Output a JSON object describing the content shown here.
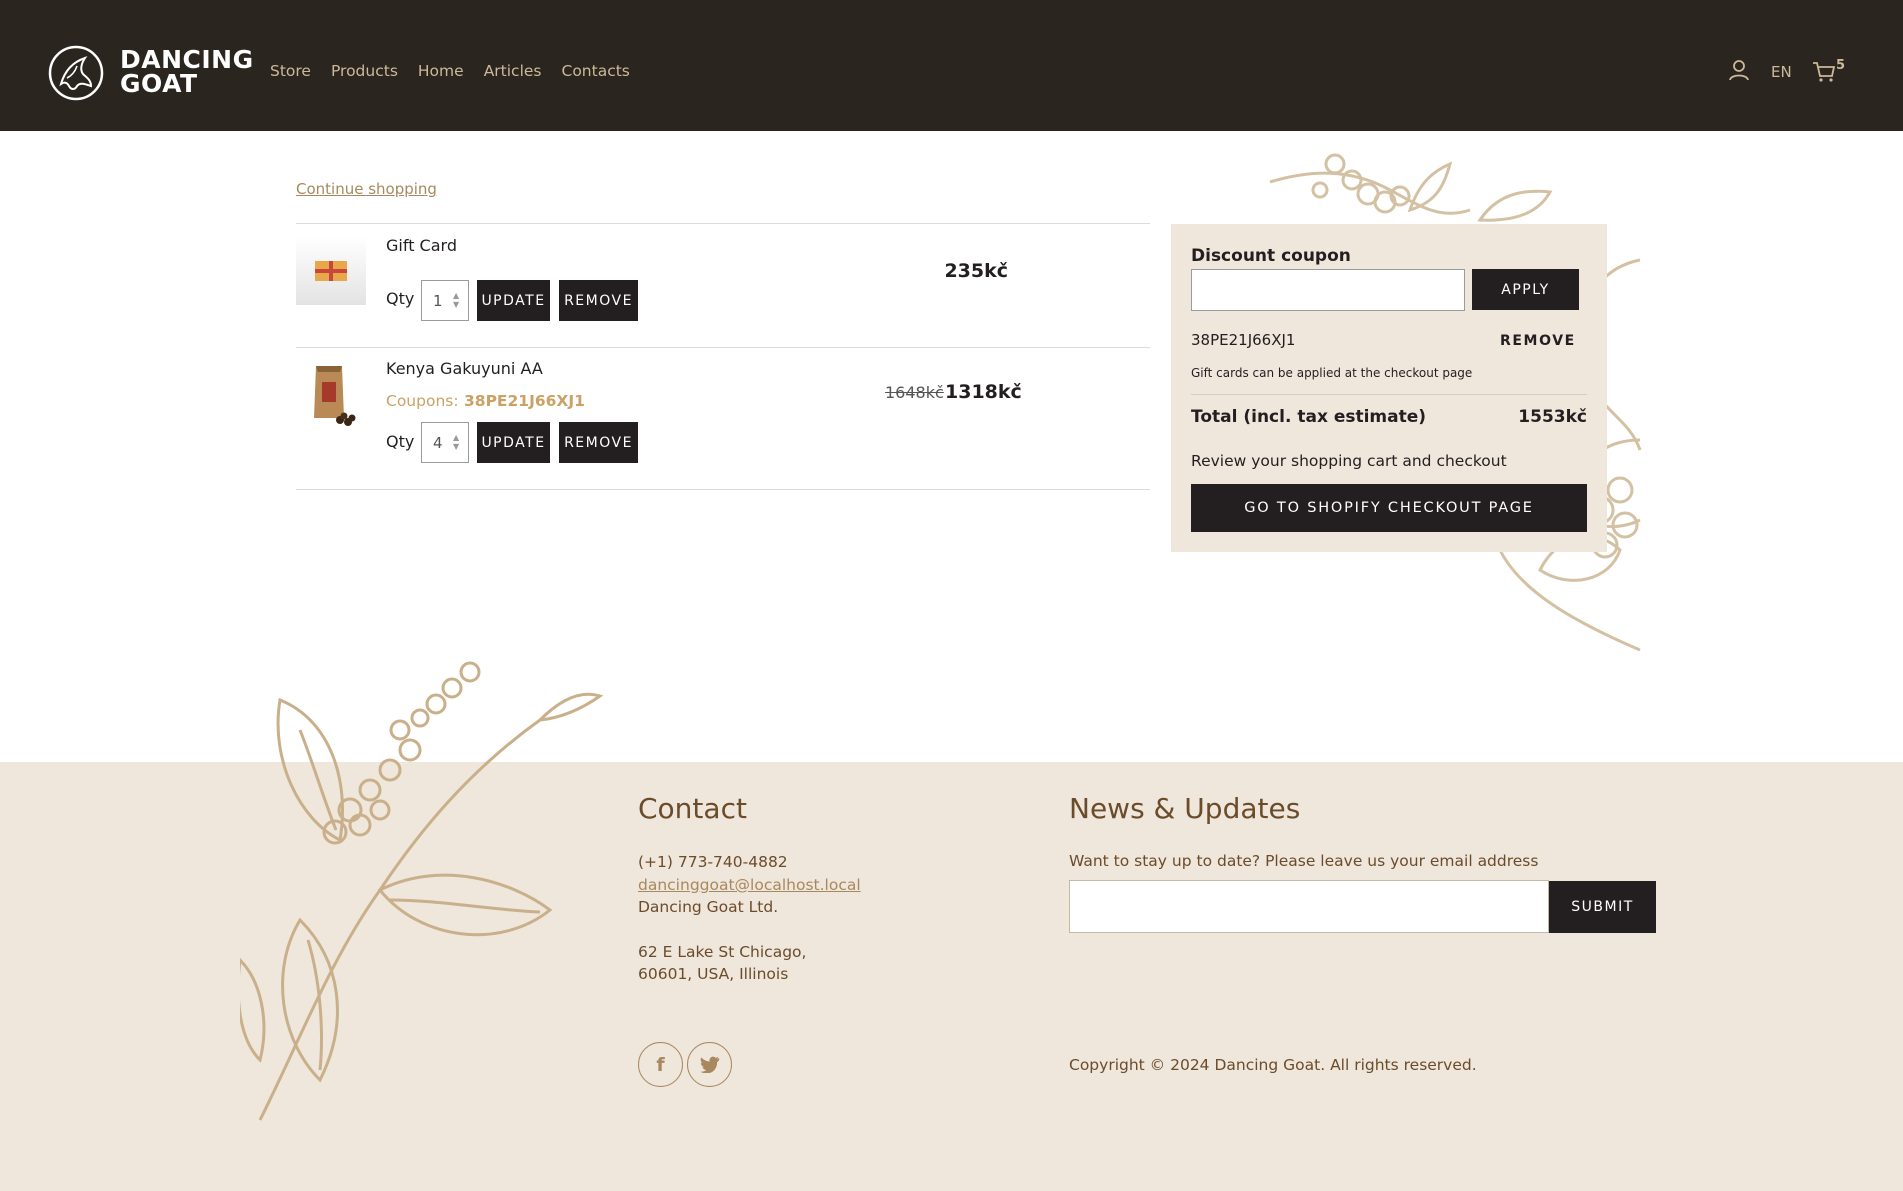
{
  "header": {
    "brand_line1": "DANCING",
    "brand_line2": "GOAT",
    "nav": [
      "Store",
      "Products",
      "Home",
      "Articles",
      "Contacts"
    ],
    "language": "EN",
    "cart_count": "5"
  },
  "cart": {
    "continue_label": "Continue shopping",
    "items": [
      {
        "name": "Gift Card",
        "qty_label": "Qty",
        "qty": "1",
        "update_label": "UPDATE",
        "remove_label": "REMOVE",
        "price": "235kč"
      },
      {
        "name": "Kenya Gakuyuni AA",
        "coupons_label": "Coupons:",
        "coupon_code": "38PE21J66XJ1",
        "qty_label": "Qty",
        "qty": "4",
        "update_label": "UPDATE",
        "remove_label": "REMOVE",
        "old_price": "1648kč",
        "price": "1318kč"
      }
    ]
  },
  "summary": {
    "title": "Discount coupon",
    "apply_label": "APPLY",
    "applied_code": "38PE21J66XJ1",
    "remove_label": "REMOVE",
    "gift_note": "Gift cards can be applied at the checkout page",
    "total_label": "Total (incl. tax estimate)",
    "total_value": "1553kč",
    "review_text": "Review your shopping cart and checkout",
    "checkout_label": "GO TO SHOPIFY CHECKOUT PAGE"
  },
  "footer": {
    "contact_title": "Contact",
    "phone": "(+1) 773-740-4882",
    "email": "dancinggoat@localhost.local",
    "company": "Dancing Goat Ltd.",
    "address1": "62 E Lake St Chicago,",
    "address2": "60601, USA, Illinois",
    "news_title": "News & Updates",
    "news_text": "Want to stay up to date? Please leave us your email address",
    "submit_label": "SUBMIT",
    "copyright": "Copyright © 2024 Dancing Goat. All rights reserved."
  },
  "colors": {
    "header_bg": "#2a251e",
    "accent_tan": "#cdb89a",
    "footer_bg": "#efe6dc",
    "button_dark": "#231f20",
    "coupon_gold": "#cba166"
  }
}
